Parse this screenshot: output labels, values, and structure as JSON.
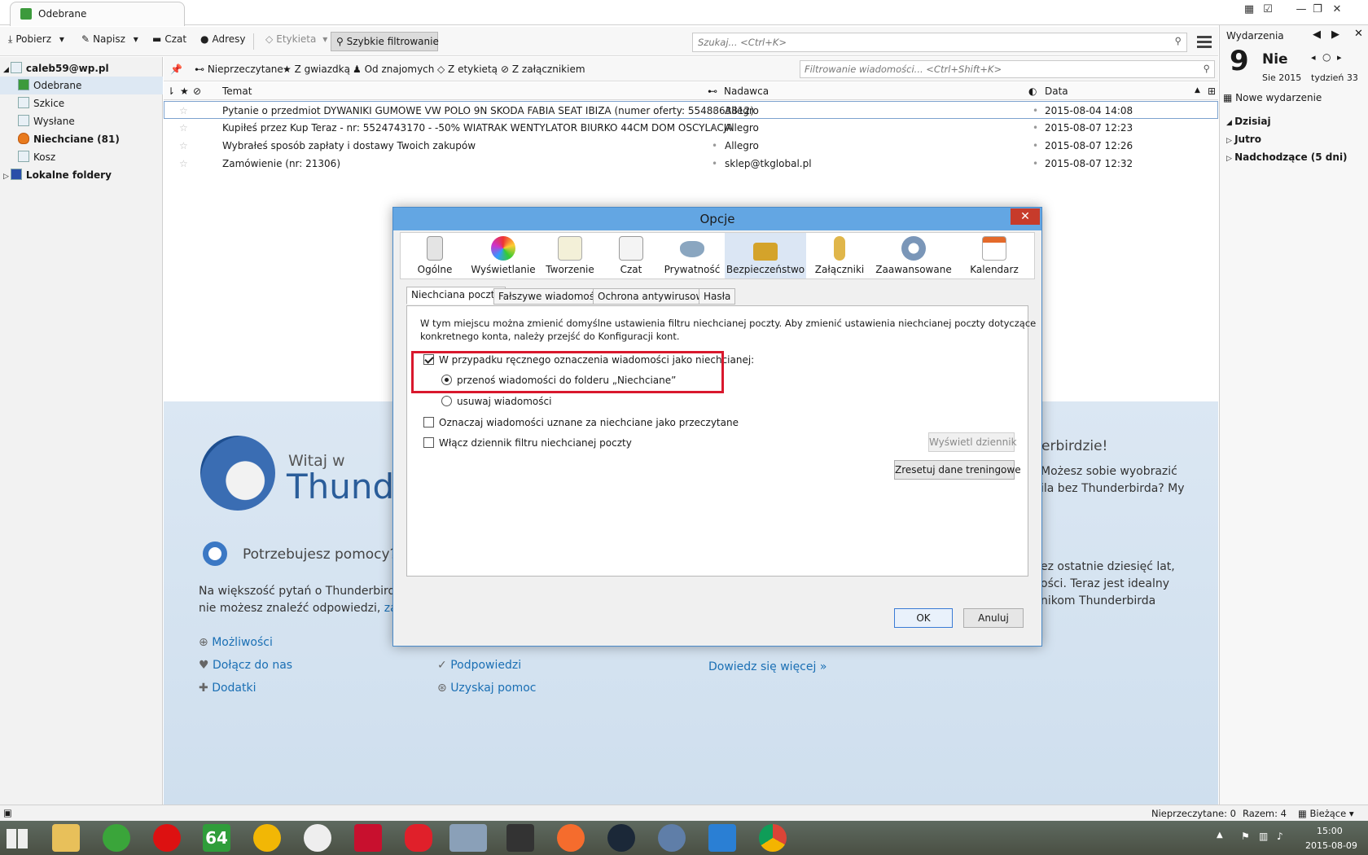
{
  "window": {
    "tab_title": "Odebrane"
  },
  "toolbar": {
    "get": "Pobierz",
    "write": "Napisz",
    "chat": "Czat",
    "address": "Adresy",
    "tag": "Etykieta",
    "quick_filter": "Szybkie filtrowanie",
    "search_placeholder": "Szukaj... <Ctrl+K>"
  },
  "folders": {
    "account": "caleb59@wp.pl",
    "items": [
      "Odebrane",
      "Szkice",
      "Wysłane",
      "Niechciane (81)",
      "Kosz"
    ],
    "local": "Lokalne foldery"
  },
  "quickfilter": {
    "unread": "Nieprzeczytane",
    "starred": "Z gwiazdką",
    "contacts": "Od znajomych",
    "tags": "Z etykietą",
    "attachments": "Z załącznikiem",
    "placeholder": "Filtrowanie wiadomości... <Ctrl+Shift+K>"
  },
  "columns": {
    "subject": "Temat",
    "sender": "Nadawca",
    "date": "Data"
  },
  "messages": [
    {
      "subject": "Pytanie o przedmiot DYWANIKI GUMOWE  VW POLO 9N SKODA FABIA SEAT IBIZA (numer oferty: 5548863812)",
      "sender": "Allegro",
      "date": "2015-08-04 14:08"
    },
    {
      "subject": "Kupiłeś przez Kup Teraz - nr: 5524743170 - -50% WIATRAK WENTYLATOR BIURKO 44CM DOM OSCYLACJA",
      "sender": "Allegro",
      "date": "2015-08-07 12:23"
    },
    {
      "subject": "Wybrałeś sposób zapłaty i dostawy Twoich zakupów",
      "sender": "Allegro",
      "date": "2015-08-07 12:26"
    },
    {
      "subject": "Zamówienie (nr: 21306)",
      "sender": "sklep@tkglobal.pl",
      "date": "2015-08-07 12:32"
    }
  ],
  "startpage": {
    "welcome_small": "Witaj w",
    "welcome_big": "Thunde",
    "help_title": "Potrzebujesz pomocy?",
    "help_line1": "Na większość pytań o Thunderbirda",
    "help_line2": "nie możesz znaleźć odpowiedzi,",
    "help_link": "zada",
    "right_title": "erbirdzie!",
    "right_line1": "Możesz sobie wyobrazić",
    "right_line2": "ila bez Thunderbirda? My",
    "right_line3": "ez ostatnie dziesięć lat,",
    "right_line4": "ości. Teraz jest idealny",
    "right_line5": "nikom Thunderbirda",
    "links_col1": [
      "Możliwości",
      "Dołącz do nas",
      "Dodatki"
    ],
    "links_col2": [
      "Podpowiedzi",
      "Uzyskaj pomoc"
    ],
    "links_col3": [
      "Dowiedz się więcej »"
    ]
  },
  "today": {
    "header": "Wydarzenia",
    "day_number": "9",
    "day_name": "Nie",
    "month_year": "Sie 2015",
    "week": "tydzień 33",
    "new_event": "Nowe wydarzenie",
    "sections": [
      "Dzisiaj",
      "Jutro",
      "Nadchodzące (5 dni)"
    ]
  },
  "status": {
    "unread": "Nieprzeczytane: 0",
    "total": "Razem: 4",
    "current": "Bieżące"
  },
  "taskbar": {
    "time": "15:00",
    "date": "2015-08-09",
    "icon_64": "64"
  },
  "dialog": {
    "title": "Opcje",
    "panels": [
      "Ogólne",
      "Wyświetlanie",
      "Tworzenie",
      "Czat",
      "Prywatność",
      "Bezpieczeństwo",
      "Załączniki",
      "Zaawansowane",
      "Kalendarz"
    ],
    "subtabs": [
      "Niechciana poczta",
      "Fałszywe wiadomości",
      "Ochrona antywirusowa",
      "Hasła"
    ],
    "description_line1": "W tym miejscu można zmienić domyślne ustawienia filtru niechcianej poczty. Aby zmienić ustawienia niechcianej poczty dotyczące",
    "description_line2": "konkretnego konta, należy przejść do Konfiguracji kont.",
    "opt_manual_mark": "W przypadku ręcznego oznaczenia wiadomości jako niechcianej:",
    "opt_move": "przenoś wiadomości do folderu „Niechciane”",
    "opt_delete": "usuwaj wiadomości",
    "opt_mark_read": "Oznaczaj wiadomości uznane za niechciane jako przeczytane",
    "opt_log": "Włącz dziennik filtru niechcianej poczty",
    "btn_show_log": "Wyświetl dziennik",
    "btn_reset": "Zresetuj dane treningowe",
    "btn_ok": "OK",
    "btn_cancel": "Anuluj"
  },
  "colors": {
    "accent": "#63a6e3",
    "highlight": "#d9182d"
  }
}
